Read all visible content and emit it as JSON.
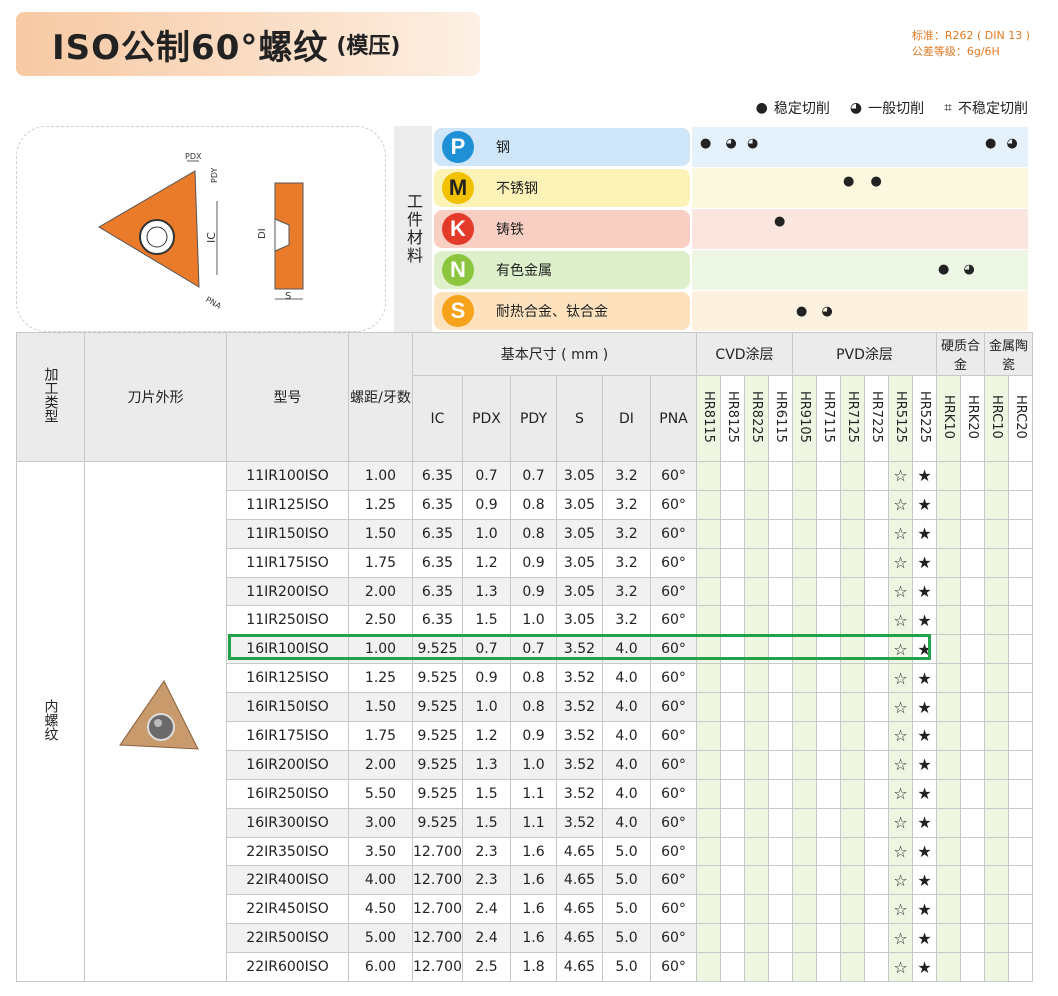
{
  "header": {
    "title": "ISO公制60°螺纹",
    "subtitle": "(模压)",
    "standard_line1": "标准：R262 ( DIN 13 )",
    "standard_line2": "公差等级：6g/6H"
  },
  "legend": [
    {
      "symbol": "●",
      "label": "稳定切削"
    },
    {
      "symbol": "◕",
      "label": "一般切削"
    },
    {
      "symbol": "⌗",
      "label": "不稳定切削"
    }
  ],
  "diagram": {
    "pdx": "PDX",
    "pdy": "PDY",
    "ic": "IC",
    "di": "DI",
    "s": "S",
    "pna": "PNA"
  },
  "workpiece_label": "工件材料",
  "materials": [
    {
      "code": "P",
      "name": "钢",
      "color": "#1f8fd6",
      "bg": "#cfe6f8",
      "band": "#e6f2fb"
    },
    {
      "code": "M",
      "name": "不锈钢",
      "color": "#f2c200",
      "bg": "#fbf2b8",
      "band": "#fcf8df"
    },
    {
      "code": "K",
      "name": "铸铁",
      "color": "#e43a2a",
      "bg": "#f8cfc2",
      "band": "#fbe6df"
    },
    {
      "code": "N",
      "name": "有色金属",
      "color": "#8cc63f",
      "bg": "#def0cb",
      "band": "#eef7e4"
    },
    {
      "code": "S",
      "name": "耐热合金、钛合金",
      "color": "#f7a21b",
      "bg": "#fde2bd",
      "band": "#fdf1df"
    }
  ],
  "table": {
    "headers": {
      "process_type": "加工类型",
      "shape": "刀片外形",
      "model": "型号",
      "pitch": "螺距/牙数",
      "basic_dims": "基本尺寸 ( mm )",
      "cvd": "CVD涂层",
      "pvd": "PVD涂层",
      "hard_alloy": "硬质合金",
      "cermet": "金属陶瓷",
      "dims": [
        "IC",
        "PDX",
        "PDY",
        "S",
        "DI",
        "PNA"
      ],
      "grades": [
        "HR8115",
        "HR8125",
        "HR8225",
        "HR6115",
        "HR9105",
        "HR7115",
        "HR7125",
        "HR7225",
        "HR5125",
        "HR5225",
        "HRK10",
        "HRK20",
        "HRC10",
        "HRC20"
      ]
    },
    "process_label": "内螺纹",
    "rows": [
      {
        "model": "11IR100ISO",
        "pitch": "1.00",
        "ic": "6.35",
        "pdx": "0.7",
        "pdy": "0.7",
        "s": "3.05",
        "di": "3.2",
        "pna": "60°"
      },
      {
        "model": "11IR125ISO",
        "pitch": "1.25",
        "ic": "6.35",
        "pdx": "0.9",
        "pdy": "0.8",
        "s": "3.05",
        "di": "3.2",
        "pna": "60°"
      },
      {
        "model": "11IR150ISO",
        "pitch": "1.50",
        "ic": "6.35",
        "pdx": "1.0",
        "pdy": "0.8",
        "s": "3.05",
        "di": "3.2",
        "pna": "60°"
      },
      {
        "model": "11IR175ISO",
        "pitch": "1.75",
        "ic": "6.35",
        "pdx": "1.2",
        "pdy": "0.9",
        "s": "3.05",
        "di": "3.2",
        "pna": "60°"
      },
      {
        "model": "11IR200ISO",
        "pitch": "2.00",
        "ic": "6.35",
        "pdx": "1.3",
        "pdy": "0.9",
        "s": "3.05",
        "di": "3.2",
        "pna": "60°"
      },
      {
        "model": "11IR250ISO",
        "pitch": "2.50",
        "ic": "6.35",
        "pdx": "1.5",
        "pdy": "1.0",
        "s": "3.05",
        "di": "3.2",
        "pna": "60°"
      },
      {
        "model": "16IR100ISO",
        "pitch": "1.00",
        "ic": "9.525",
        "pdx": "0.7",
        "pdy": "0.7",
        "s": "3.52",
        "di": "4.0",
        "pna": "60°"
      },
      {
        "model": "16IR125ISO",
        "pitch": "1.25",
        "ic": "9.525",
        "pdx": "0.9",
        "pdy": "0.8",
        "s": "3.52",
        "di": "4.0",
        "pna": "60°"
      },
      {
        "model": "16IR150ISO",
        "pitch": "1.50",
        "ic": "9.525",
        "pdx": "1.0",
        "pdy": "0.8",
        "s": "3.52",
        "di": "4.0",
        "pna": "60°"
      },
      {
        "model": "16IR175ISO",
        "pitch": "1.75",
        "ic": "9.525",
        "pdx": "1.2",
        "pdy": "0.9",
        "s": "3.52",
        "di": "4.0",
        "pna": "60°"
      },
      {
        "model": "16IR200ISO",
        "pitch": "2.00",
        "ic": "9.525",
        "pdx": "1.3",
        "pdy": "1.0",
        "s": "3.52",
        "di": "4.0",
        "pna": "60°"
      },
      {
        "model": "16IR250ISO",
        "pitch": "5.50",
        "ic": "9.525",
        "pdx": "1.5",
        "pdy": "1.1",
        "s": "3.52",
        "di": "4.0",
        "pna": "60°"
      },
      {
        "model": "16IR300ISO",
        "pitch": "3.00",
        "ic": "9.525",
        "pdx": "1.5",
        "pdy": "1.1",
        "s": "3.52",
        "di": "4.0",
        "pna": "60°"
      },
      {
        "model": "22IR350ISO",
        "pitch": "3.50",
        "ic": "12.700",
        "pdx": "2.3",
        "pdy": "1.6",
        "s": "4.65",
        "di": "5.0",
        "pna": "60°"
      },
      {
        "model": "22IR400ISO",
        "pitch": "4.00",
        "ic": "12.700",
        "pdx": "2.3",
        "pdy": "1.6",
        "s": "4.65",
        "di": "5.0",
        "pna": "60°"
      },
      {
        "model": "22IR450ISO",
        "pitch": "4.50",
        "ic": "12.700",
        "pdx": "2.4",
        "pdy": "1.6",
        "s": "4.65",
        "di": "5.0",
        "pna": "60°"
      },
      {
        "model": "22IR500ISO",
        "pitch": "5.00",
        "ic": "12.700",
        "pdx": "2.4",
        "pdy": "1.6",
        "s": "4.65",
        "di": "5.0",
        "pna": "60°"
      },
      {
        "model": "22IR600ISO",
        "pitch": "6.00",
        "ic": "12.700",
        "pdx": "2.5",
        "pdy": "1.8",
        "s": "4.65",
        "di": "5.0",
        "pna": "60°"
      }
    ],
    "grade_marks": {
      "hr5125": "☆",
      "hr5225": "★"
    }
  }
}
